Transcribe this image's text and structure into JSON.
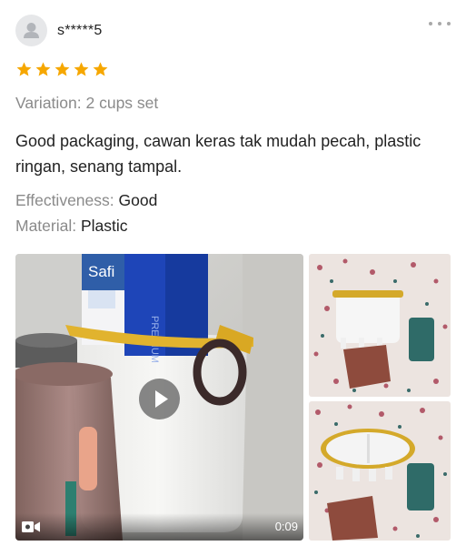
{
  "reviewer": {
    "username": "s*****5",
    "avatar_icon": "user-icon"
  },
  "more_icon": "more-dots-icon",
  "rating": {
    "value": 5,
    "max": 5,
    "star_color": "#f6a700"
  },
  "variation": "Variation: 2 cups set",
  "review_text": "Good packaging, cawan keras tak mudah pecah, plastic ringan, senang tampal.",
  "attributes": [
    {
      "key": "Effectiveness:",
      "value": "Good"
    },
    {
      "key": "Material:",
      "value": "Plastic"
    }
  ],
  "media": {
    "video": {
      "duration": "0:09",
      "play_icon": "play-icon",
      "camera_icon": "video-camera-icon",
      "product_label": "Safi",
      "brand_label": "PREMIUM"
    },
    "photos": 2
  }
}
